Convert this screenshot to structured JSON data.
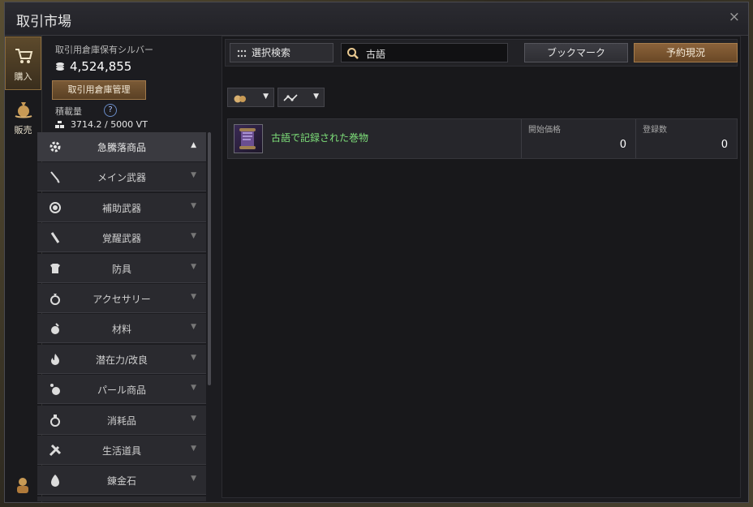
{
  "window": {
    "title": "取引市場",
    "close_symbol": "×"
  },
  "tabs": {
    "buy": "購入",
    "sell": "販売"
  },
  "info": {
    "silver_label": "取引用倉庫保有シルバー",
    "silver_value": "4,524,855",
    "warehouse_button": "取引用倉庫管理",
    "weight_label": "積載量",
    "help_symbol": "?",
    "weight_value": "3714.2 / 5000 VT"
  },
  "categories": [
    {
      "label": "急騰落商品",
      "icon": "gear-icon",
      "active": true
    },
    {
      "label": "メイン武器",
      "icon": "sword-icon"
    },
    {
      "label": "補助武器",
      "icon": "shield-icon"
    },
    {
      "label": "覚醒武器",
      "icon": "awakening-sword-icon"
    },
    {
      "label": "防具",
      "icon": "armor-icon"
    },
    {
      "label": "アクセサリー",
      "icon": "ring-icon"
    },
    {
      "label": "材料",
      "icon": "material-icon"
    },
    {
      "label": "潜在力/改良",
      "icon": "flame-icon"
    },
    {
      "label": "パール商品",
      "icon": "pearl-icon"
    },
    {
      "label": "消耗品",
      "icon": "potion-icon"
    },
    {
      "label": "生活道具",
      "icon": "tools-icon"
    },
    {
      "label": "錬金石",
      "icon": "alchemy-stone-icon"
    }
  ],
  "arrows": {
    "up": "▲",
    "down": "▼"
  },
  "toolbar": {
    "select_search": "選択検索",
    "search_value": "古語",
    "bookmark": "ブックマーク",
    "reservation": "予約現況"
  },
  "results": [
    {
      "name": "古語で記録された巻物",
      "col1_label": "開始価格",
      "col1_value": "0",
      "col2_label": "登録数",
      "col2_value": "0"
    }
  ],
  "colors": {
    "accent": "#8a623a",
    "item_name": "#7ee07a"
  }
}
